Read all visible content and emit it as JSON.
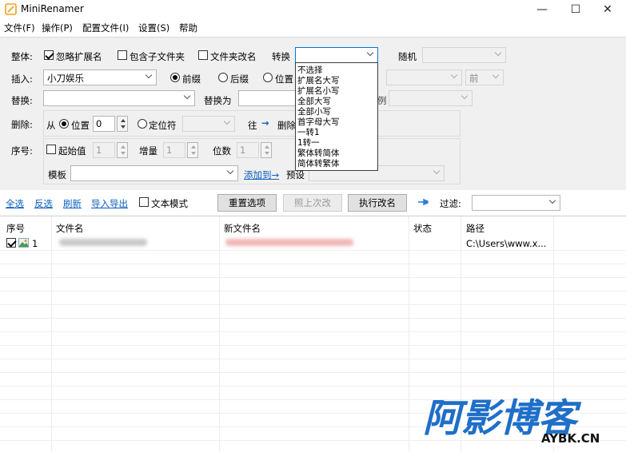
{
  "window": {
    "title": "MiniRenamer",
    "controls": [
      "—",
      "☐",
      "✕"
    ]
  },
  "menu": [
    "文件(F)",
    "操作(P)",
    "配置文件(I)",
    "设置(S)",
    "帮助"
  ],
  "whole": {
    "label": "整体:",
    "ignore_ext": "忽略扩展名",
    "include_subfolders": "包含子文件夹",
    "folder_rename": "文件夹改名",
    "convert_label": "转换",
    "convert_value": "",
    "random_label": "随机",
    "random_value": ""
  },
  "convert_options": [
    "不选择",
    "扩展名大写",
    "扩展名小写",
    "全部大写",
    "全部小写",
    "首字母大写",
    "一转1",
    "1转一",
    "繁体转简体",
    "简体转繁体"
  ],
  "insert": {
    "label": "插入:",
    "value": "小刀娱乐",
    "prefix": "前缀",
    "suffix": "后缀",
    "position": "位置",
    "pos_combo": "前"
  },
  "replace": {
    "label": "替换:",
    "with_label": "替换为",
    "partial_label": "例"
  },
  "delete": {
    "label": "删除:",
    "from_label": "从",
    "position": "位置",
    "position_value": "0",
    "locator": "定位符",
    "to_label": "往",
    "arrow": "→",
    "delete_word": "删除"
  },
  "sequence": {
    "label": "序号:",
    "start_label": "起始值",
    "start_value": "1",
    "increment_label": "增量",
    "increment_value": "1",
    "digits_label": "位数",
    "digits_value": "1"
  },
  "template": {
    "label": "模板",
    "add_link": "添加到→",
    "preset_label": "预设"
  },
  "toolbar": {
    "select_all": "全选",
    "invert": "反选",
    "refresh": "刷新",
    "import_export": "导入导出",
    "text_mode": "文本模式",
    "reset": "重置选项",
    "same_as_last": "照上次改",
    "execute": "执行改名",
    "filter_label": "过滤:"
  },
  "table": {
    "headers": [
      "序号",
      "文件名",
      "新文件名",
      "状态",
      "路径"
    ],
    "rows": [
      {
        "index": "1",
        "filename": "",
        "new_filename": "",
        "status": "",
        "path": "C:\\Users\\www.x..."
      }
    ]
  },
  "watermark": {
    "main": "阿影博客",
    "sub": "AYBK.CN"
  },
  "colors": {
    "accent": "#0078d7",
    "link": "#0b5fbf",
    "watermark": "#1f6fc9"
  }
}
